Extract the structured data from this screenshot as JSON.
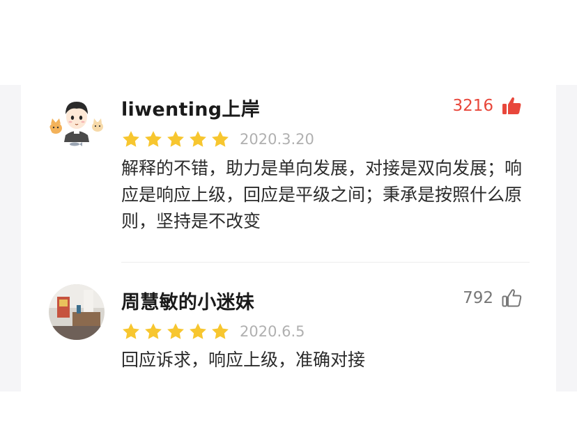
{
  "colors": {
    "star": "#f7c62f",
    "like_active": "#e8473b",
    "like_inactive": "#777777",
    "date": "#b0b0b0",
    "text": "#2b2b2b"
  },
  "reviews": [
    {
      "username": "liwenting上岸",
      "avatar_icon": "cartoon-boy-with-cats-avatar",
      "like_count": "3216",
      "liked": true,
      "like_icon": "thumbs-up-filled-icon",
      "rating": 5,
      "date": "2020.3.20",
      "content": "解释的不错，助力是单向发展，对接是双向发展；响应是响应上级，回应是平级之间；秉承是按照什么原则，坚持是不改变"
    },
    {
      "username": "周慧敏的小迷妹",
      "avatar_icon": "room-photo-avatar",
      "like_count": "792",
      "liked": false,
      "like_icon": "thumbs-up-outline-icon",
      "rating": 5,
      "date": "2020.6.5",
      "content": "回应诉求，响应上级，准确对接"
    }
  ]
}
